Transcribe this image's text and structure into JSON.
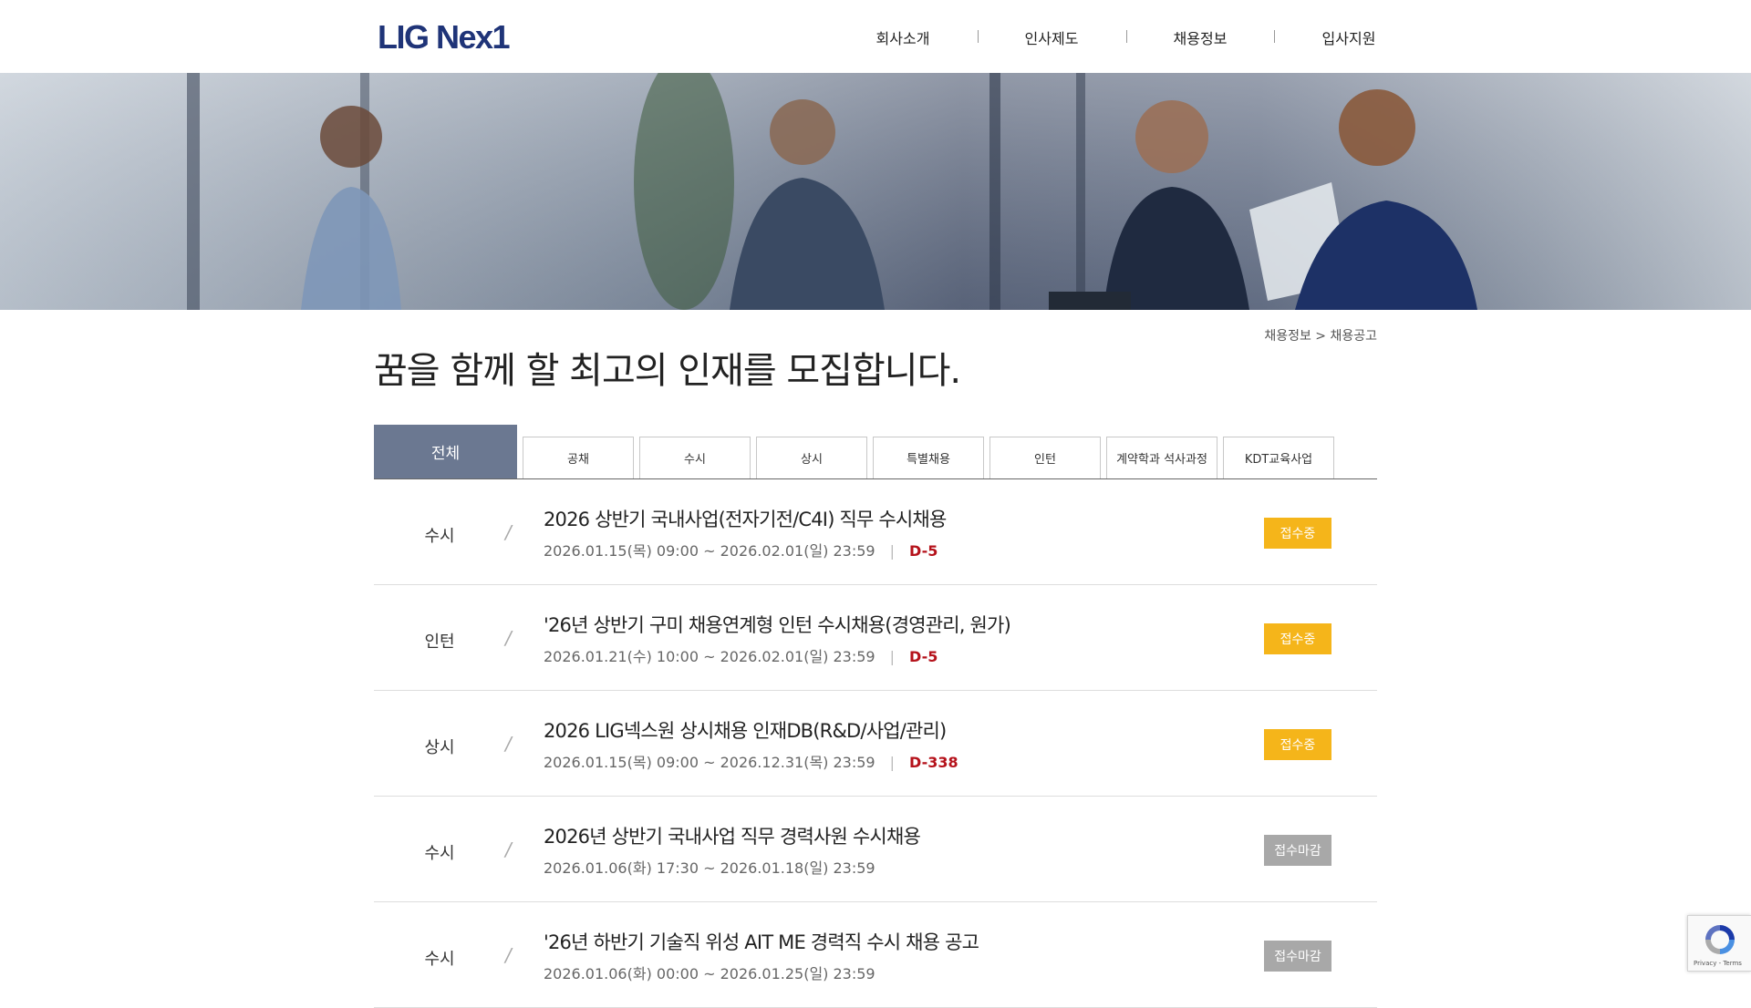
{
  "header": {
    "logo": "LIG Nex1",
    "nav": [
      {
        "label": "회사소개"
      },
      {
        "label": "인사제도"
      },
      {
        "label": "채용정보"
      },
      {
        "label": "입사지원"
      }
    ],
    "nav_separator": "|"
  },
  "banner": {
    "image": "business-meeting-photo"
  },
  "breadcrumb": "채용정보 > 채용공고",
  "page_title": "꿈을 함께 할 최고의 인재를 모집합니다.",
  "tabs": {
    "active": "전체",
    "items": [
      {
        "label": "공채"
      },
      {
        "label": "수시"
      },
      {
        "label": "상시"
      },
      {
        "label": "특별채용"
      },
      {
        "label": "인턴"
      },
      {
        "label": "계약학과 석사과정"
      },
      {
        "label": "KDT교육사업"
      }
    ]
  },
  "postings": [
    {
      "category": "수시",
      "slash": "/",
      "title": "2026 상반기 국내사업(전자기전/C4I) 직무 수시채용",
      "period": "2026.01.15(목) 09:00 ~ 2026.02.01(일) 23:59",
      "divider": "|",
      "dday": "D-5",
      "status": "접수중"
    },
    {
      "category": "인턴",
      "slash": "/",
      "title": "'26년 상반기 구미 채용연계형 인턴 수시채용(경영관리, 원가)",
      "period": "2026.01.21(수) 10:00 ~ 2026.02.01(일) 23:59",
      "divider": "|",
      "dday": "D-5",
      "status": "접수중"
    },
    {
      "category": "상시",
      "slash": "/",
      "title": "2026 LIG넥스원 상시채용 인재DB(R&D/사업/관리)",
      "period": "2026.01.15(목) 09:00 ~ 2026.12.31(목) 23:59",
      "divider": "|",
      "dday": "D-338",
      "status": "접수중"
    },
    {
      "category": "수시",
      "slash": "/",
      "title": "2026년 상반기 국내사업 직무 경력사원 수시채용",
      "period": "2026.01.06(화) 17:30 ~ 2026.01.18(일) 23:59",
      "divider": "",
      "dday": "",
      "status": "접수마감"
    },
    {
      "category": "수시",
      "slash": "/",
      "title": "'26년 하반기 기술직 위성 AIT ME 경력직 수시 채용 공고",
      "period": "2026.01.06(화) 00:00 ~ 2026.01.25(일) 23:59",
      "divider": "",
      "dday": "",
      "status": "접수마감"
    }
  ],
  "recaptcha": {
    "footer": "Privacy - Terms"
  },
  "colors": {
    "brand": "#1f3478",
    "tab_active": "#6b7891",
    "status_open": "#f5b51a",
    "status_closed": "#a8a8a8",
    "dday": "#b5121b"
  }
}
